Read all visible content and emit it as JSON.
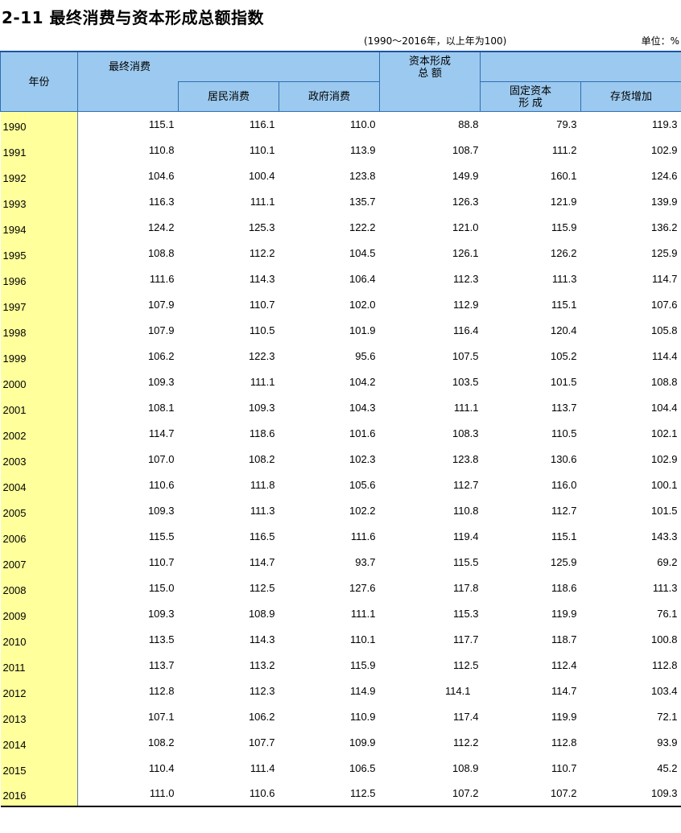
{
  "title": "2-11  最终消费与资本形成总额指数",
  "note": "(1990～2016年，以上年为100)",
  "unit": "单位：%",
  "headers": {
    "year": "年份",
    "final_consumption": "最终消费",
    "household": "居民消费",
    "government": "政府消费",
    "gcf_line1": "资本形成",
    "gcf_line2": "总      额",
    "fixed_line1": "固定资本",
    "fixed_line2": "形      成",
    "inventory": "存货增加"
  },
  "rows": [
    {
      "year": "1990",
      "final": "115.1",
      "household": "116.1",
      "government": "110.0",
      "gcf": "88.8",
      "fixed": "79.3",
      "inventory": "119.3"
    },
    {
      "year": "1991",
      "final": "110.8",
      "household": "110.1",
      "government": "113.9",
      "gcf": "108.7",
      "fixed": "111.2",
      "inventory": "102.9"
    },
    {
      "year": "1992",
      "final": "104.6",
      "household": "100.4",
      "government": "123.8",
      "gcf": "149.9",
      "fixed": "160.1",
      "inventory": "124.6"
    },
    {
      "year": "1993",
      "final": "116.3",
      "household": "111.1",
      "government": "135.7",
      "gcf": "126.3",
      "fixed": "121.9",
      "inventory": "139.9"
    },
    {
      "year": "1994",
      "final": "124.2",
      "household": "125.3",
      "government": "122.2",
      "gcf": "121.0",
      "fixed": "115.9",
      "inventory": "136.2"
    },
    {
      "year": "1995",
      "final": "108.8",
      "household": "112.2",
      "government": "104.5",
      "gcf": "126.1",
      "fixed": "126.2",
      "inventory": "125.9"
    },
    {
      "year": "1996",
      "final": "111.6",
      "household": "114.3",
      "government": "106.4",
      "gcf": "112.3",
      "fixed": "111.3",
      "inventory": "114.7"
    },
    {
      "year": "1997",
      "final": "107.9",
      "household": "110.7",
      "government": "102.0",
      "gcf": "112.9",
      "fixed": "115.1",
      "inventory": "107.6"
    },
    {
      "year": "1998",
      "final": "107.9",
      "household": "110.5",
      "government": "101.9",
      "gcf": "116.4",
      "fixed": "120.4",
      "inventory": "105.8"
    },
    {
      "year": "1999",
      "final": "106.2",
      "household": "122.3",
      "government": "95.6",
      "gcf": "107.5",
      "fixed": "105.2",
      "inventory": "114.4"
    },
    {
      "year": "2000",
      "final": "109.3",
      "household": "111.1",
      "government": "104.2",
      "gcf": "103.5",
      "fixed": "101.5",
      "inventory": "108.8"
    },
    {
      "year": "2001",
      "final": "108.1",
      "household": "109.3",
      "government": "104.3",
      "gcf": "111.1",
      "fixed": "113.7",
      "inventory": "104.4"
    },
    {
      "year": "2002",
      "final": "114.7",
      "household": "118.6",
      "government": "101.6",
      "gcf": "108.3",
      "fixed": "110.5",
      "inventory": "102.1"
    },
    {
      "year": "2003",
      "final": "107.0",
      "household": "108.2",
      "government": "102.3",
      "gcf": "123.8",
      "fixed": "130.6",
      "inventory": "102.9"
    },
    {
      "year": "2004",
      "final": "110.6",
      "household": "111.8",
      "government": "105.6",
      "gcf": "112.7",
      "fixed": "116.0",
      "inventory": "100.1"
    },
    {
      "year": "2005",
      "final": "109.3",
      "household": "111.3",
      "government": "102.2",
      "gcf": "110.8",
      "fixed": "112.7",
      "inventory": "101.5"
    },
    {
      "year": "2006",
      "final": "115.5",
      "household": "116.5",
      "government": "111.6",
      "gcf": "119.4",
      "fixed": "115.1",
      "inventory": "143.3"
    },
    {
      "year": "2007",
      "final": "110.7",
      "household": "114.7",
      "government": "93.7",
      "gcf": "115.5",
      "fixed": "125.9",
      "inventory": "69.2"
    },
    {
      "year": "2008",
      "final": "115.0",
      "household": "112.5",
      "government": "127.6",
      "gcf": "117.8",
      "fixed": "118.6",
      "inventory": "111.3"
    },
    {
      "year": "2009",
      "final": "109.3",
      "household": "108.9",
      "government": "111.1",
      "gcf": "115.3",
      "fixed": "119.9",
      "inventory": "76.1"
    },
    {
      "year": "2010",
      "final": "113.5",
      "household": "114.3",
      "government": "110.1",
      "gcf": "117.7",
      "fixed": "118.7",
      "inventory": "100.8"
    },
    {
      "year": "2011",
      "final": "113.7",
      "household": "113.2",
      "government": "115.9",
      "gcf": "112.5",
      "fixed": "112.4",
      "inventory": "112.8"
    },
    {
      "year": "2012",
      "final": "112.8",
      "household": "112.3",
      "government": "114.9",
      "gcf": "114.1",
      "fixed": "114.7",
      "inventory": "103.4"
    },
    {
      "year": "2013",
      "final": "107.1",
      "household": "106.2",
      "government": "110.9",
      "gcf": "117.4",
      "fixed": "119.9",
      "inventory": "72.1"
    },
    {
      "year": "2014",
      "final": "108.2",
      "household": "107.7",
      "government": "109.9",
      "gcf": "112.2",
      "fixed": "112.8",
      "inventory": "93.9"
    },
    {
      "year": "2015",
      "final": "110.4",
      "household": "111.4",
      "government": "106.5",
      "gcf": "108.9",
      "fixed": "110.7",
      "inventory": "45.2"
    },
    {
      "year": "2016",
      "final": "111.0",
      "household": "110.6",
      "government": "112.5",
      "gcf": "107.2",
      "fixed": "107.2",
      "inventory": "109.3"
    }
  ]
}
